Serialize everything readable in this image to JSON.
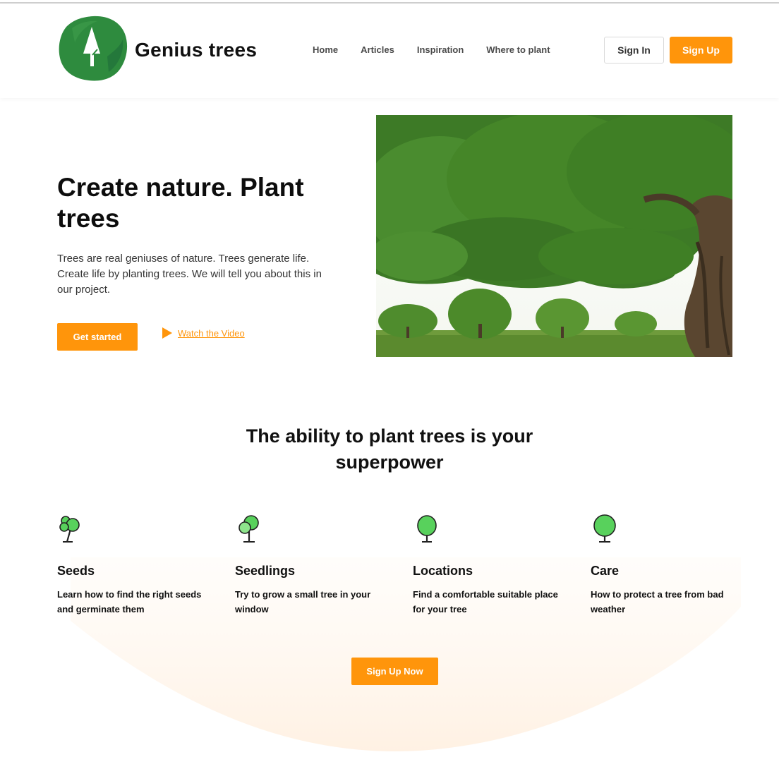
{
  "header": {
    "brand": "Genius trees",
    "nav": [
      "Home",
      "Articles",
      "Inspiration",
      "Where to plant"
    ],
    "sign_in": "Sign In",
    "sign_up": "Sign Up"
  },
  "hero": {
    "title": "Create nature. Plant trees",
    "text": "Trees are real geniuses of nature. Trees generate life. Create life by planting trees. We will tell you about this in our project.",
    "cta": "Get started",
    "video_link": "Watch the Video"
  },
  "section": {
    "title": "The ability to plant trees is your superpower",
    "features": [
      {
        "icon": "tree-seeds-icon",
        "title": "Seeds",
        "desc": "Learn how to find the right seeds and germinate them"
      },
      {
        "icon": "tree-seedlings-icon",
        "title": "Seedlings",
        "desc": "Try to grow a small tree in your window"
      },
      {
        "icon": "tree-locations-icon",
        "title": "Locations",
        "desc": "Find a comfortable suitable place for your tree"
      },
      {
        "icon": "tree-care-icon",
        "title": "Care",
        "desc": "How to protect a tree from bad weather"
      }
    ],
    "cta": "Sign Up Now"
  },
  "colors": {
    "accent": "#ff950b",
    "logo_green": "#2e8b3e",
    "icon_green": "#58d15c"
  }
}
